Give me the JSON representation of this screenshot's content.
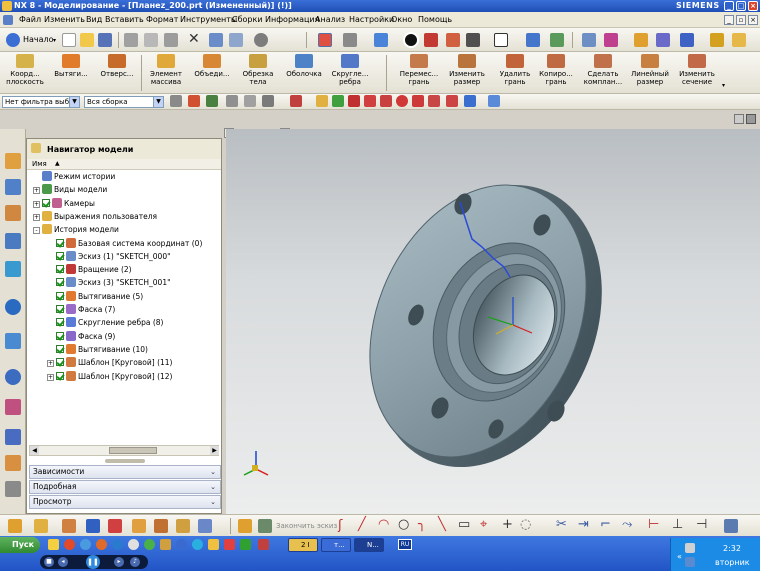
{
  "window": {
    "title": "NX 8 - Моделирование - [Планеz_200.prt (Измененный)]   (!)]",
    "brand": "SIEMENS",
    "buttons": [
      "minimize",
      "maximize",
      "close"
    ]
  },
  "menu": {
    "items": [
      "Файл",
      "Изменить",
      "Вид",
      "Вставить",
      "Формат",
      "Инструменты",
      "Сборки",
      "Информация",
      "Анализ",
      "Настройки",
      "Окно",
      "Помощь"
    ]
  },
  "toolbar1": {
    "start_label": "Начало"
  },
  "toolbar2": {
    "buttons": [
      "Коорд...\nплоскость",
      "Вытяги...",
      "Отверс...",
      "Элемент\nмассива",
      "Объеди...",
      "Обрезка\nтела",
      "Оболочка",
      "Скругле...\nребра",
      "Перемес...\nгрань",
      "Изменить\nразмер",
      "Удалить\nгрань",
      "Копиро...\nгрань",
      "Сделать\nкомплан...",
      "Линейный\nразмер",
      "Изменить\nсечение"
    ]
  },
  "toolbar3": {
    "filter": "Нет фильтра выб",
    "assembly": "Вся сборка"
  },
  "navigator": {
    "title": "Навигатор модели",
    "column": "Имя",
    "rows": [
      {
        "label": "Режим истории",
        "indent": 0,
        "expand": "",
        "check": false
      },
      {
        "label": "Виды модели",
        "indent": 0,
        "expand": "+",
        "check": false
      },
      {
        "label": "Камеры",
        "indent": 0,
        "expand": "+",
        "check": true
      },
      {
        "label": "Выражения пользователя",
        "indent": 0,
        "expand": "+",
        "check": false
      },
      {
        "label": "История модели",
        "indent": 0,
        "expand": "-",
        "check": false
      },
      {
        "label": "Базовая система координат (0)",
        "indent": 1,
        "expand": "",
        "check": true
      },
      {
        "label": "Эскиз (1) \"SKETCH_000\"",
        "indent": 1,
        "expand": "",
        "check": true
      },
      {
        "label": "Вращение (2)",
        "indent": 1,
        "expand": "",
        "check": true
      },
      {
        "label": "Эскиз (3) \"SKETCH_001\"",
        "indent": 1,
        "expand": "",
        "check": true
      },
      {
        "label": "Вытягивание (5)",
        "indent": 1,
        "expand": "",
        "check": true
      },
      {
        "label": "Фаска (7)",
        "indent": 1,
        "expand": "",
        "check": true
      },
      {
        "label": "Скругление ребра (8)",
        "indent": 1,
        "expand": "",
        "check": true
      },
      {
        "label": "Фаска (9)",
        "indent": 1,
        "expand": "",
        "check": true
      },
      {
        "label": "Вытягивание (10)",
        "indent": 1,
        "expand": "",
        "check": true
      },
      {
        "label": "Шаблон [Круговой] (11)",
        "indent": 1,
        "expand": "+",
        "check": true
      },
      {
        "label": "Шаблон [Круговой] (12)",
        "indent": 1,
        "expand": "+",
        "check": true
      }
    ],
    "panels": [
      "Зависимости",
      "Подробная",
      "Просмотр"
    ]
  },
  "bottom_toolbar": {
    "finish_sketch": "Закончить эскиз"
  },
  "taskbar": {
    "start": "Пуск",
    "tasks": [
      "2 I",
      "т...",
      "N..."
    ],
    "lang": "RU",
    "time": "2:32",
    "day": "вторник"
  },
  "colors": {
    "title_bar": "#2452be",
    "menu_bg": "#ece9d8",
    "viewport_top": "#b9bec2",
    "viewport_bottom": "#eceded",
    "part": "#8fa3ad",
    "taskbar": "#2f62d0"
  }
}
